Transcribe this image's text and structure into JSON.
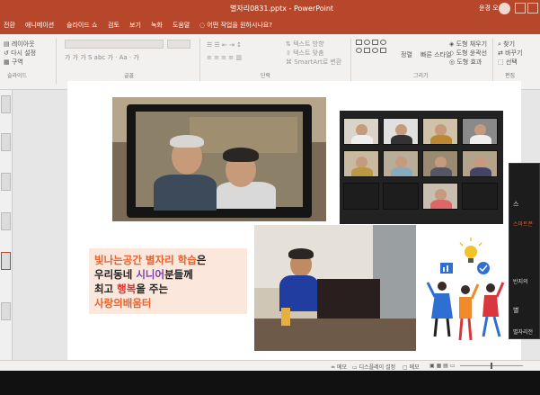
{
  "window": {
    "filename": "별자리0831.pptx",
    "app": "PowerPoint",
    "title_separator": " - ",
    "user": "윤경 오"
  },
  "tabs": [
    "전환",
    "애니메이션",
    "슬라이드 쇼",
    "검토",
    "보기",
    "녹화",
    "도움말"
  ],
  "tell_me": "어떤 작업을 원하시나요?",
  "ribbon": {
    "slide_buttons": [
      "레이아웃",
      "다시 설정",
      "구역"
    ],
    "font_group": "글꼴",
    "paragraph_buttons": [
      "텍스트 방향",
      "텍스트 맞춤",
      "SmartArt로 변환"
    ],
    "paragraph_group": "단락",
    "drawing_buttons": [
      "정렬",
      "빠른 스타일"
    ],
    "drawing_group": "그리기",
    "shape_options": [
      "도형 채우기",
      "도형 윤곽선",
      "도형 효과"
    ],
    "editing_buttons": [
      "찾기",
      "바꾸기",
      "선택"
    ],
    "editing_group": "편집",
    "slide_group": "슬라이드"
  },
  "slide": {
    "text_lines": [
      {
        "parts": [
          {
            "t": "빛나는공간 ",
            "c": "orange"
          },
          {
            "t": "별자리 학습",
            "c": "orange"
          },
          {
            "t": "은",
            "c": "default"
          }
        ]
      },
      {
        "parts": [
          {
            "t": "우리동네 ",
            "c": "default"
          },
          {
            "t": "시니어",
            "c": "purple"
          },
          {
            "t": "분들께",
            "c": "default"
          }
        ]
      },
      {
        "parts": [
          {
            "t": "최고 ",
            "c": "default"
          },
          {
            "t": "행복",
            "c": "red"
          },
          {
            "t": "을 주는",
            "c": "default"
          }
        ]
      },
      {
        "parts": [
          {
            "t": "사랑의배움터",
            "c": "orange"
          }
        ]
      }
    ]
  },
  "zoom_panel": {
    "items": [
      "스",
      "스마트폰",
      "반지의",
      "별",
      "별자리전"
    ]
  },
  "statusbar": {
    "notes": "메모",
    "display": "디스플레이 설정",
    "comments": "메모"
  },
  "colors": {
    "accent": "#b7472a",
    "orange": "#e8622c",
    "purple": "#7a3fb3",
    "red": "#e0312d"
  }
}
